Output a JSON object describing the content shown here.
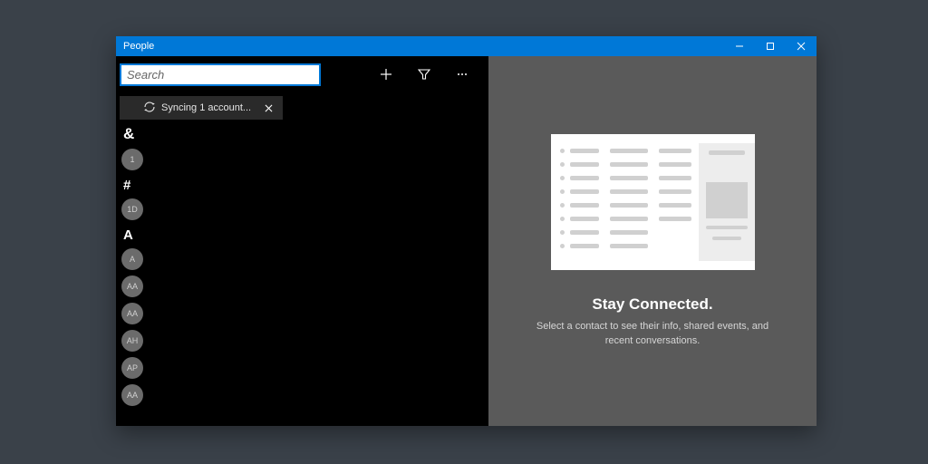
{
  "window": {
    "title": "People"
  },
  "toolbar": {
    "search_placeholder": "Search",
    "add_label": "Add",
    "filter_label": "Filter",
    "more_label": "More"
  },
  "sync": {
    "text": "Syncing 1 account...",
    "close_label": "Dismiss"
  },
  "sections": [
    {
      "label": "&",
      "class": "section-amp",
      "items": [
        "1"
      ]
    },
    {
      "label": "#",
      "class": "section-hash",
      "items": [
        "1D"
      ]
    },
    {
      "label": "A",
      "class": "section-a",
      "items": [
        "A",
        "AA",
        "AA",
        "AH",
        "AP",
        "AA"
      ]
    }
  ],
  "empty": {
    "title": "Stay Connected.",
    "subtitle": "Select a contact to see their info, shared events, and recent conversations."
  }
}
